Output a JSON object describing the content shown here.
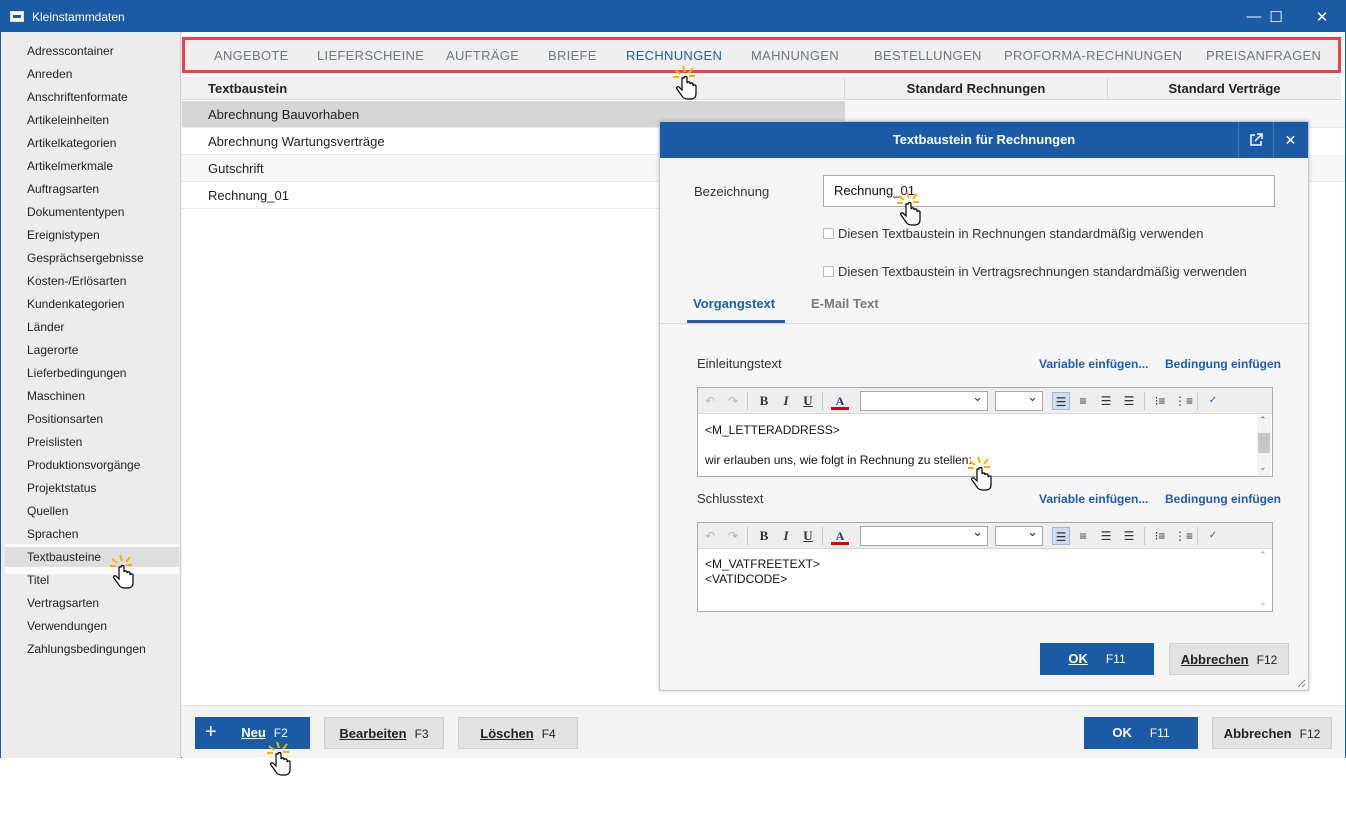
{
  "window": {
    "title": "Kleinstammdaten",
    "controls": {
      "minimize": "—",
      "maximize": "☐",
      "close": "✕"
    }
  },
  "sidebar": {
    "items": [
      "Adresscontainer",
      "Anreden",
      "Anschriftenformate",
      "Artikeleinheiten",
      "Artikelkategorien",
      "Artikelmerkmale",
      "Auftragsarten",
      "Dokumententypen",
      "Ereignistypen",
      "Gesprächsergebnisse",
      "Kosten-/Erlösarten",
      "Kundenkategorien",
      "Länder",
      "Lagerorte",
      "Lieferbedingungen",
      "Maschinen",
      "Positionsarten",
      "Preislisten",
      "Produktionsvorgänge",
      "Projektstatus",
      "Quellen",
      "Sprachen",
      "Textbausteine",
      "Titel",
      "Vertragsarten",
      "Verwendungen",
      "Zahlungsbedingungen"
    ],
    "selected": "Textbausteine"
  },
  "tabs": {
    "items": [
      "ANGEBOTE",
      "LIEFERSCHEINE",
      "AUFTRÄGE",
      "BRIEFE",
      "RECHNUNGEN",
      "MAHNUNGEN",
      "BESTELLUNGEN",
      "PROFORMA-RECHNUNGEN",
      "PREISANFRAGEN"
    ],
    "active": "RECHNUNGEN"
  },
  "table": {
    "columns": [
      "Textbaustein",
      "Standard Rechnungen",
      "Standard Verträge"
    ],
    "rows": [
      "Abrechnung Bauvorhaben",
      "Abrechnung Wartungsverträge",
      "Gutschrift",
      "Rechnung_01"
    ],
    "selected": "Abrechnung Bauvorhaben"
  },
  "bottom": {
    "new_label": "Neu",
    "new_key": "F2",
    "new_icon": "+",
    "edit_label": "Bearbeiten",
    "edit_key": "F3",
    "delete_label": "Löschen",
    "delete_key": "F4",
    "ok_label": "OK",
    "ok_key": "F11",
    "cancel_label": "Abbrechen",
    "cancel_key": "F12"
  },
  "dialog": {
    "title": "Textbaustein für Rechnungen",
    "bezeichnung_label": "Bezeichnung",
    "bezeichnung_value": "Rechnung_01",
    "check_rechnungen": "Diesen Textbaustein in Rechnungen standardmäßig verwenden",
    "check_vertraege": "Diesen Textbaustein in Vertragsrechnungen standardmäßig verwenden",
    "tabs": [
      "Vorgangstext",
      "E-Mail Text"
    ],
    "active_tab": "Vorgangstext",
    "intro_label": "Einleitungstext",
    "intro_text_line1": "<M_LETTERADDRESS>",
    "intro_text_line2": "wir erlauben uns, wie folgt in Rechnung zu stellen:",
    "closing_label": "Schlusstext",
    "closing_text": "<M_VATFREETEXT>\n<VATIDCODE>",
    "var_link": "Variable einfügen...",
    "cond_link": "Bedingung einfügen",
    "ok_label": "OK",
    "ok_key": "F11",
    "cancel_label": "Abbrechen",
    "cancel_key": "F12"
  },
  "colors": {
    "accent": "#1b5aa5",
    "highlight_border": "#e8424c",
    "active_tab": "#1d5dab"
  }
}
